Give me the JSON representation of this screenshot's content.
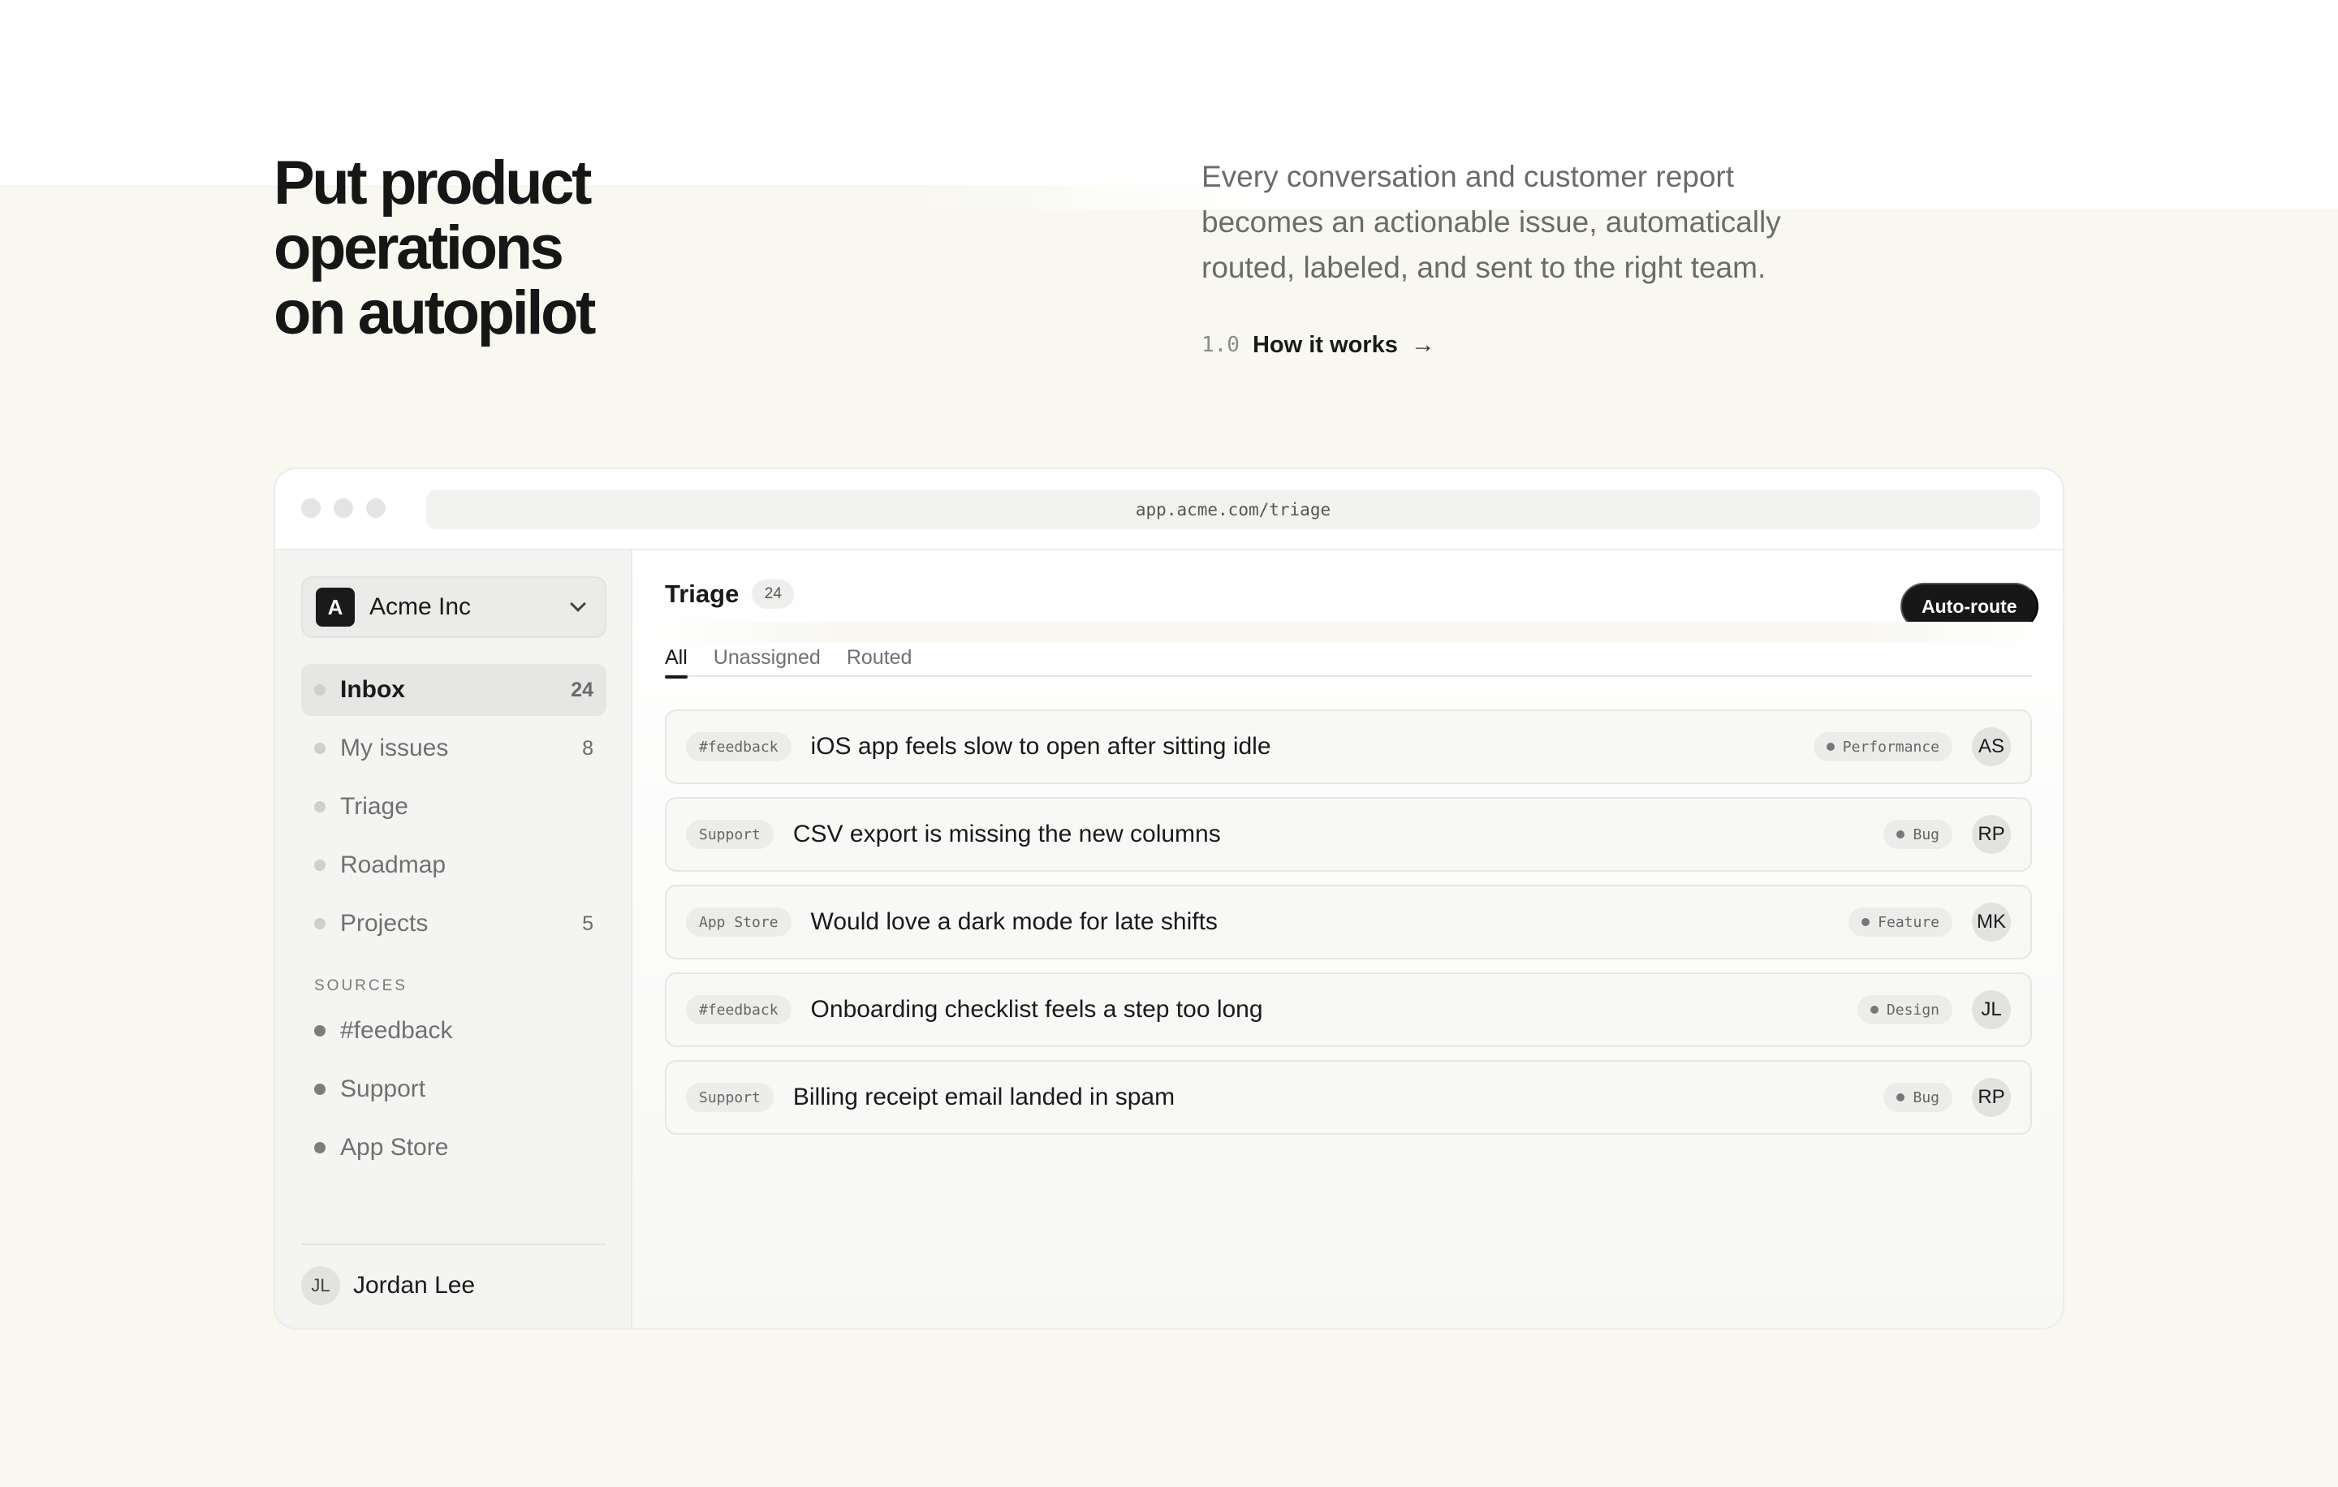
{
  "hero": {
    "title_line1": "Put product operations",
    "title_line2": "on autopilot",
    "subtitle": "Every conversation and customer report becomes an actionable issue, automatically routed, labeled, and sent to the right team.",
    "link_number": "1.0",
    "link_label": "How it works",
    "link_icon": "arrow-right-icon"
  },
  "browser": {
    "url": "app.acme.com/triage"
  },
  "sidebar": {
    "workspace_logo": "A",
    "workspace_name": "Acme Inc",
    "workspace_icon": "chevron-down-icon",
    "nav": [
      {
        "label": "Inbox",
        "count": "24",
        "active": true
      },
      {
        "label": "My issues",
        "count": "8",
        "active": false
      },
      {
        "label": "Triage",
        "count": "",
        "active": false
      },
      {
        "label": "Roadmap",
        "count": "",
        "active": false
      },
      {
        "label": "Projects",
        "count": "5",
        "active": false
      }
    ],
    "sources_title": "SOURCES",
    "sources": [
      {
        "label": "#feedback"
      },
      {
        "label": "Support"
      },
      {
        "label": "App Store"
      }
    ],
    "user_initials": "JL",
    "user_name": "Jordan Lee"
  },
  "main": {
    "title": "Triage",
    "count": "24",
    "auto_route_label": "Auto-route",
    "tabs": [
      {
        "label": "All",
        "active": true
      },
      {
        "label": "Unassigned",
        "active": false
      },
      {
        "label": "Routed",
        "active": false
      }
    ],
    "rows": [
      {
        "source": "#feedback",
        "title": "iOS app feels slow to open after sitting idle",
        "label": "Performance",
        "assignee": "AS"
      },
      {
        "source": "Support",
        "title": "CSV export is missing the new columns",
        "label": "Bug",
        "assignee": "RP"
      },
      {
        "source": "App Store",
        "title": "Would love a dark mode for late shifts",
        "label": "Feature",
        "assignee": "MK"
      },
      {
        "source": "#feedback",
        "title": "Onboarding checklist feels a step too long",
        "label": "Design",
        "assignee": "JL"
      },
      {
        "source": "Support",
        "title": "Billing receipt email landed in spam",
        "label": "Bug",
        "assignee": "RP"
      }
    ]
  },
  "colors": {
    "page_background": "#f8f8f0",
    "primary_button": "#171717",
    "text_primary": "#1a1a1a",
    "text_muted": "#707070"
  }
}
